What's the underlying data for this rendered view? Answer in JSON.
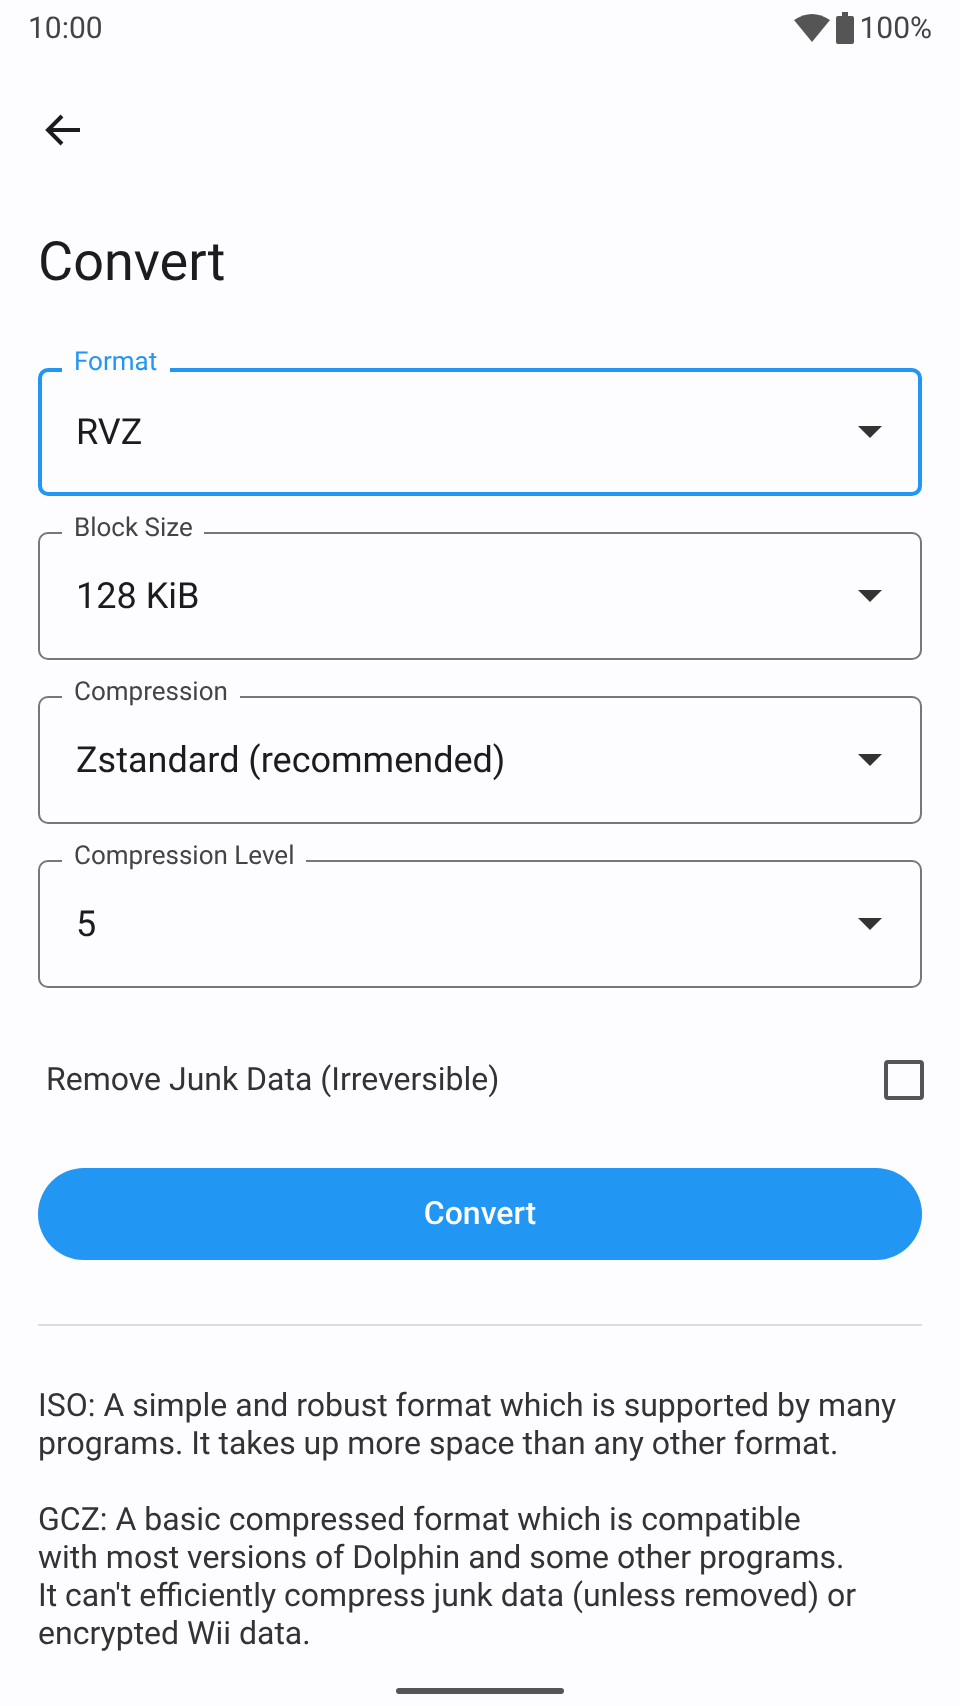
{
  "status_bar": {
    "time": "10:00",
    "battery": "100%"
  },
  "title": "Convert",
  "fields": [
    {
      "label": "Format",
      "value": "RVZ",
      "focused": true
    },
    {
      "label": "Block Size",
      "value": "128 KiB",
      "focused": false
    },
    {
      "label": "Compression",
      "value": "Zstandard (recommended)",
      "focused": false
    },
    {
      "label": "Compression Level",
      "value": "5",
      "focused": false
    }
  ],
  "checkbox": {
    "label": "Remove Junk Data (Irreversible)",
    "checked": false
  },
  "button": "Convert",
  "descriptions": [
    "ISO: A simple and robust format which is supported by many programs. It takes up more space than any other format.",
    "GCZ: A basic compressed format which is compatible\nwith most versions of Dolphin and some other programs.\nIt can't efficiently compress junk data (unless removed) or\nencrypted Wii data."
  ]
}
